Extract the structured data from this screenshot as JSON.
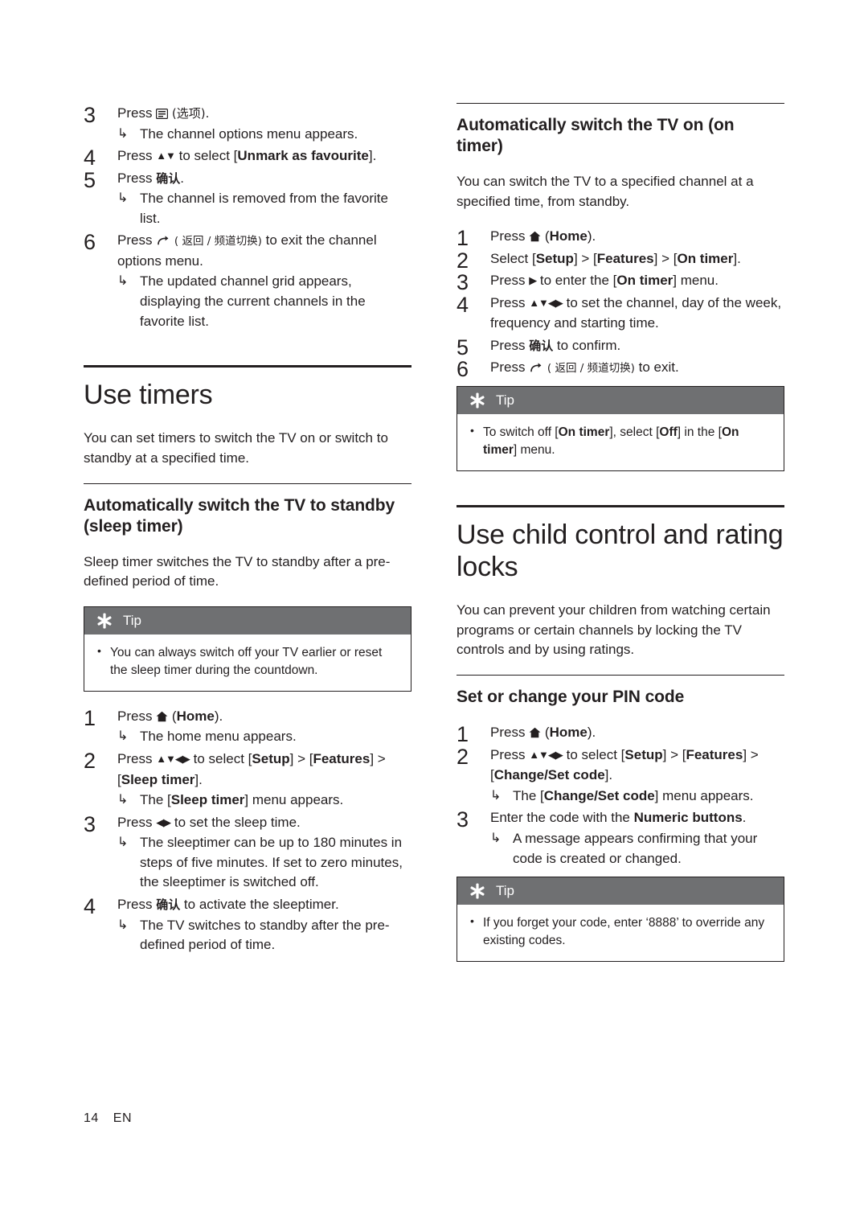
{
  "page": {
    "number": "14",
    "lang": "EN"
  },
  "icons": {
    "home": "home-icon",
    "options": "options-icon",
    "back": "back-icon",
    "tip_star": "tip-star-icon",
    "arrow_right": "▶",
    "arrow_updown": "▲▼",
    "arrow_all": "▲▼◀▶",
    "arrow_leftright": "◀▶",
    "sub_arrow": "↪"
  },
  "left_column": {
    "steps_top": [
      {
        "num": "3",
        "text_before": "Press ",
        "icon": "options-icon",
        "text_after": " (选项).",
        "subs": [
          "The channel options menu appears."
        ]
      },
      {
        "num": "4",
        "text_before": "Press ",
        "arrows": "▲▼",
        "text_after": " to select [Unmark as favourite].",
        "bold_part": "Unmark as favourite",
        "subs": []
      },
      {
        "num": "5",
        "text_before": "Press ",
        "cn": "确认",
        "text_after": ".",
        "subs": [
          "The channel is removed from the favorite list."
        ]
      },
      {
        "num": "6",
        "text_before": "Press ",
        "icon": "back-icon",
        "cn": "( 返回 / 频道切换)",
        "text_after": " to exit the channel options menu.",
        "subs": [
          "The updated channel grid appears, displaying the current channels in the favorite list."
        ]
      }
    ],
    "section_title": "Use timers",
    "section_intro": "You can set timers to switch the TV on or switch to standby at a specified time.",
    "subsection_title": "Automatically switch the TV to standby (sleep timer)",
    "subsection_intro": "Sleep timer switches the TV to standby after a pre-defined period of time.",
    "tip": {
      "label": "Tip",
      "items": [
        "You can always switch off your TV earlier or reset the sleep timer during the countdown."
      ]
    },
    "steps_bottom": [
      {
        "num": "1",
        "text_before": "Press ",
        "icon": "home-icon",
        "text_after": " (Home).",
        "subs": [
          "The home menu appears."
        ]
      },
      {
        "num": "2",
        "text_before": "Press ",
        "arrows": "▲▼◀▶",
        "text_after": " to select [Setup] > [Features] > [Sleep timer].",
        "subs": [
          "The [Sleep timer] menu appears."
        ]
      },
      {
        "num": "3",
        "text_before": "Press ",
        "arrows": "◀▶",
        "text_after": " to set the sleep time.",
        "subs": [
          "The sleeptimer can be up to 180 minutes in steps of five minutes. If set to zero minutes, the sleeptimer is switched off."
        ]
      },
      {
        "num": "4",
        "text_before": "Press ",
        "cn": "确认",
        "text_after": " to activate the sleeptimer.",
        "subs": [
          "The TV switches to standby after the pre-defined period of time."
        ]
      }
    ]
  },
  "right_column": {
    "subsection1_title": "Automatically switch the TV on (on timer)",
    "subsection1_intro": "You can switch the TV to a specified channel at a specified time, from standby.",
    "steps1": [
      {
        "num": "1",
        "text_before": "Press ",
        "icon": "home-icon",
        "text_after": " (Home).",
        "subs": []
      },
      {
        "num": "2",
        "text_before": "Select [Setup] > [Features] > [On timer].",
        "subs": []
      },
      {
        "num": "3",
        "text_before": "Press ",
        "arrows": "▶",
        "text_after": " to enter the [On timer] menu.",
        "subs": []
      },
      {
        "num": "4",
        "text_before": "Press ",
        "arrows": "▲▼◀▶",
        "text_after": " to set the channel, day of the week, frequency and starting time.",
        "subs": []
      },
      {
        "num": "5",
        "text_before": "Press ",
        "cn": "确认",
        "text_after": " to confirm.",
        "subs": []
      },
      {
        "num": "6",
        "text_before": "Press ",
        "icon": "back-icon",
        "cn": "( 返回 / 频道切换)",
        "text_after": " to exit.",
        "subs": []
      }
    ],
    "tip1": {
      "label": "Tip",
      "items": [
        "To switch off [On timer], select [Off] in the [On timer] menu."
      ]
    },
    "section_title": "Use child control and rating locks",
    "section_intro": "You can prevent your children from watching certain programs or certain channels by locking the TV controls and by using ratings.",
    "subsection2_title": "Set or change your PIN code",
    "steps2": [
      {
        "num": "1",
        "text_before": "Press ",
        "icon": "home-icon",
        "text_after": " (Home).",
        "subs": []
      },
      {
        "num": "2",
        "text_before": "Press ",
        "arrows": "▲▼◀▶",
        "text_after": " to select [Setup] > [Features] > [Change/Set code].",
        "subs": [
          "The [Change/Set code] menu appears."
        ]
      },
      {
        "num": "3",
        "text_before": "Enter the code with the Numeric buttons.",
        "subs": [
          "A message appears confirming that your code is created or changed."
        ]
      }
    ],
    "tip2": {
      "label": "Tip",
      "items": [
        "If you forget your code, enter ‘8888’ to override any existing codes."
      ]
    }
  }
}
